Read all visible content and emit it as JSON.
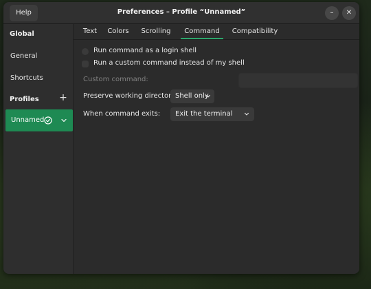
{
  "window": {
    "title": "Preferences – Profile “Unnamed”",
    "help_label": "Help",
    "minimize_glyph": "–",
    "close_glyph": "✕"
  },
  "sidebar": {
    "global_heading": "Global",
    "items": [
      {
        "label": "General"
      },
      {
        "label": "Shortcuts"
      }
    ],
    "profiles_heading": "Profiles",
    "add_glyph": "+",
    "profile": {
      "name": "Unnamed",
      "is_default": true,
      "accent": "#1e8a53"
    }
  },
  "tabs": [
    {
      "label": "Text",
      "active": false
    },
    {
      "label": "Colors",
      "active": false
    },
    {
      "label": "Scrolling",
      "active": false
    },
    {
      "label": "Command",
      "active": true
    },
    {
      "label": "Compatibility",
      "active": false
    }
  ],
  "command": {
    "login_shell": {
      "label": "Run command as a login shell",
      "checked": false
    },
    "custom_command_toggle": {
      "label": "Run a custom command instead of my shell",
      "checked": false
    },
    "custom_command": {
      "label": "Custom command:",
      "value": "",
      "enabled": false
    },
    "preserve_dir": {
      "label": "Preserve working directory:",
      "selected": "Shell only"
    },
    "on_exit": {
      "label": "When command exits:",
      "selected": "Exit the terminal"
    }
  },
  "colors": {
    "accent": "#2ca66b",
    "window_bg": "#2b2b2b",
    "headerbar_bg": "#303030"
  },
  "icons": {
    "default_profile": "check-circle-icon",
    "profile_menu": "chevron-down-icon",
    "add_profile": "plus-icon",
    "minimize": "minimize-icon",
    "close": "close-icon"
  }
}
